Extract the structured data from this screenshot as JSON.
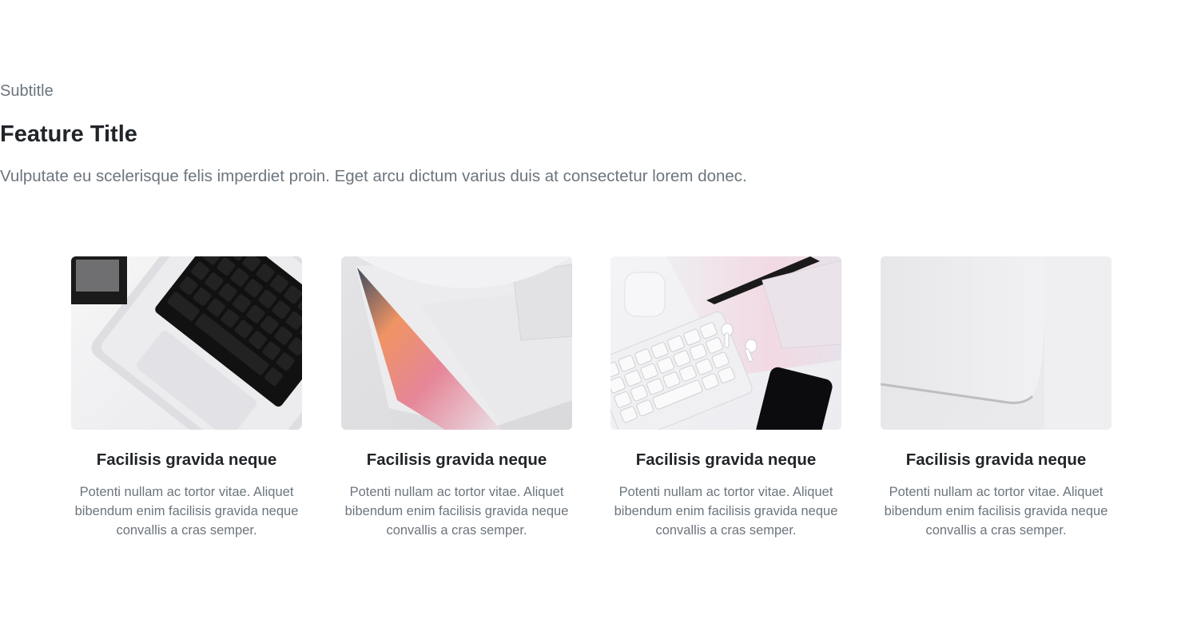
{
  "header": {
    "subtitle": "Subtitle",
    "title": "Feature Title",
    "lead": "Vulputate eu scelerisque felis imperdiet proin. Eget arcu dictum varius duis at consectetur lorem donec."
  },
  "cards": [
    {
      "image": "laptop-keyboard-photo",
      "title": "Facilisis gravida neque",
      "text": "Potenti nullam ac tortor vitae. Aliquet bibendum enim facilisis gravida neque convallis a cras semper."
    },
    {
      "image": "laptop-open-gradient-photo",
      "title": "Facilisis gravida neque",
      "text": "Potenti nullam ac tortor vitae. Aliquet bibendum enim facilisis gravida neque convallis a cras semper."
    },
    {
      "image": "desk-keyboard-earbuds-phone-photo",
      "title": "Facilisis gravida neque",
      "text": "Potenti nullam ac tortor vitae. Aliquet bibendum enim facilisis gravida neque convallis a cras semper."
    },
    {
      "image": "laptop-lid-closeup-photo",
      "title": "Facilisis gravida neque",
      "text": "Potenti nullam ac tortor vitae. Aliquet bibendum enim facilisis gravida neque convallis a cras semper."
    }
  ],
  "colors": {
    "background": "#ffffff",
    "heading": "#212529",
    "muted": "#6c757d"
  }
}
